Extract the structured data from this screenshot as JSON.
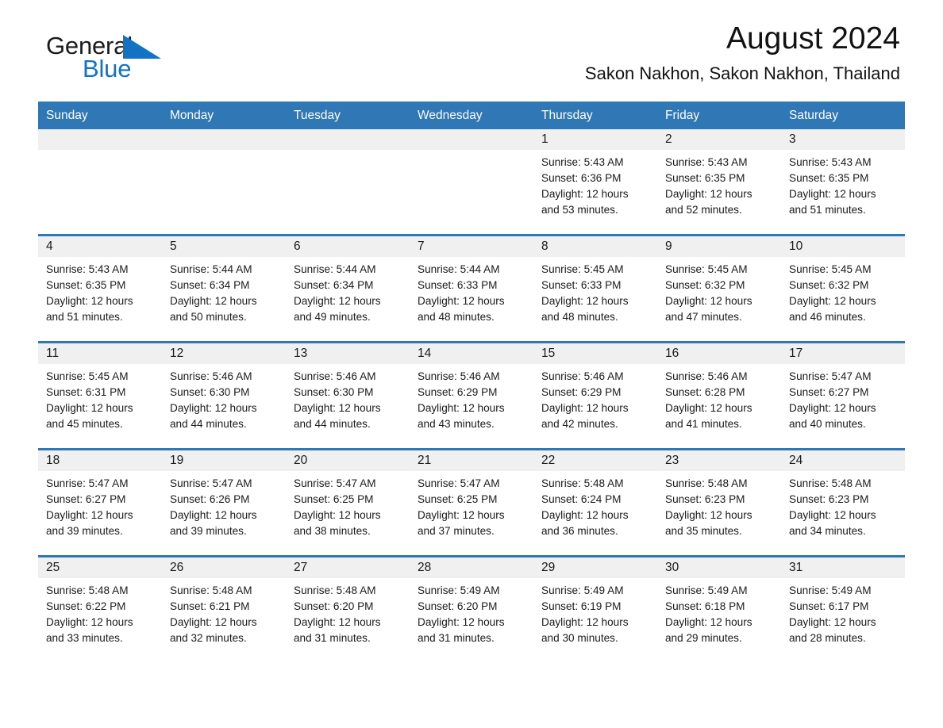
{
  "brand": {
    "name_part1": "General",
    "name_part2": "Blue",
    "flag_icon": "blue-triangle-flag-icon",
    "primary_color": "#1273c4"
  },
  "header": {
    "title": "August 2024",
    "subtitle": "Sakon Nakhon, Sakon Nakhon, Thailand"
  },
  "calendar": {
    "header_bg": "#3077b5",
    "row_divider": "#2f78b7",
    "day_band_bg": "#f0f0f0",
    "weekdays": [
      "Sunday",
      "Monday",
      "Tuesday",
      "Wednesday",
      "Thursday",
      "Friday",
      "Saturday"
    ],
    "weeks": [
      [
        {
          "day": "",
          "sunrise": "",
          "sunset": "",
          "daylight1": "",
          "daylight2": ""
        },
        {
          "day": "",
          "sunrise": "",
          "sunset": "",
          "daylight1": "",
          "daylight2": ""
        },
        {
          "day": "",
          "sunrise": "",
          "sunset": "",
          "daylight1": "",
          "daylight2": ""
        },
        {
          "day": "",
          "sunrise": "",
          "sunset": "",
          "daylight1": "",
          "daylight2": ""
        },
        {
          "day": "1",
          "sunrise": "Sunrise: 5:43 AM",
          "sunset": "Sunset: 6:36 PM",
          "daylight1": "Daylight: 12 hours",
          "daylight2": "and 53 minutes."
        },
        {
          "day": "2",
          "sunrise": "Sunrise: 5:43 AM",
          "sunset": "Sunset: 6:35 PM",
          "daylight1": "Daylight: 12 hours",
          "daylight2": "and 52 minutes."
        },
        {
          "day": "3",
          "sunrise": "Sunrise: 5:43 AM",
          "sunset": "Sunset: 6:35 PM",
          "daylight1": "Daylight: 12 hours",
          "daylight2": "and 51 minutes."
        }
      ],
      [
        {
          "day": "4",
          "sunrise": "Sunrise: 5:43 AM",
          "sunset": "Sunset: 6:35 PM",
          "daylight1": "Daylight: 12 hours",
          "daylight2": "and 51 minutes."
        },
        {
          "day": "5",
          "sunrise": "Sunrise: 5:44 AM",
          "sunset": "Sunset: 6:34 PM",
          "daylight1": "Daylight: 12 hours",
          "daylight2": "and 50 minutes."
        },
        {
          "day": "6",
          "sunrise": "Sunrise: 5:44 AM",
          "sunset": "Sunset: 6:34 PM",
          "daylight1": "Daylight: 12 hours",
          "daylight2": "and 49 minutes."
        },
        {
          "day": "7",
          "sunrise": "Sunrise: 5:44 AM",
          "sunset": "Sunset: 6:33 PM",
          "daylight1": "Daylight: 12 hours",
          "daylight2": "and 48 minutes."
        },
        {
          "day": "8",
          "sunrise": "Sunrise: 5:45 AM",
          "sunset": "Sunset: 6:33 PM",
          "daylight1": "Daylight: 12 hours",
          "daylight2": "and 48 minutes."
        },
        {
          "day": "9",
          "sunrise": "Sunrise: 5:45 AM",
          "sunset": "Sunset: 6:32 PM",
          "daylight1": "Daylight: 12 hours",
          "daylight2": "and 47 minutes."
        },
        {
          "day": "10",
          "sunrise": "Sunrise: 5:45 AM",
          "sunset": "Sunset: 6:32 PM",
          "daylight1": "Daylight: 12 hours",
          "daylight2": "and 46 minutes."
        }
      ],
      [
        {
          "day": "11",
          "sunrise": "Sunrise: 5:45 AM",
          "sunset": "Sunset: 6:31 PM",
          "daylight1": "Daylight: 12 hours",
          "daylight2": "and 45 minutes."
        },
        {
          "day": "12",
          "sunrise": "Sunrise: 5:46 AM",
          "sunset": "Sunset: 6:30 PM",
          "daylight1": "Daylight: 12 hours",
          "daylight2": "and 44 minutes."
        },
        {
          "day": "13",
          "sunrise": "Sunrise: 5:46 AM",
          "sunset": "Sunset: 6:30 PM",
          "daylight1": "Daylight: 12 hours",
          "daylight2": "and 44 minutes."
        },
        {
          "day": "14",
          "sunrise": "Sunrise: 5:46 AM",
          "sunset": "Sunset: 6:29 PM",
          "daylight1": "Daylight: 12 hours",
          "daylight2": "and 43 minutes."
        },
        {
          "day": "15",
          "sunrise": "Sunrise: 5:46 AM",
          "sunset": "Sunset: 6:29 PM",
          "daylight1": "Daylight: 12 hours",
          "daylight2": "and 42 minutes."
        },
        {
          "day": "16",
          "sunrise": "Sunrise: 5:46 AM",
          "sunset": "Sunset: 6:28 PM",
          "daylight1": "Daylight: 12 hours",
          "daylight2": "and 41 minutes."
        },
        {
          "day": "17",
          "sunrise": "Sunrise: 5:47 AM",
          "sunset": "Sunset: 6:27 PM",
          "daylight1": "Daylight: 12 hours",
          "daylight2": "and 40 minutes."
        }
      ],
      [
        {
          "day": "18",
          "sunrise": "Sunrise: 5:47 AM",
          "sunset": "Sunset: 6:27 PM",
          "daylight1": "Daylight: 12 hours",
          "daylight2": "and 39 minutes."
        },
        {
          "day": "19",
          "sunrise": "Sunrise: 5:47 AM",
          "sunset": "Sunset: 6:26 PM",
          "daylight1": "Daylight: 12 hours",
          "daylight2": "and 39 minutes."
        },
        {
          "day": "20",
          "sunrise": "Sunrise: 5:47 AM",
          "sunset": "Sunset: 6:25 PM",
          "daylight1": "Daylight: 12 hours",
          "daylight2": "and 38 minutes."
        },
        {
          "day": "21",
          "sunrise": "Sunrise: 5:47 AM",
          "sunset": "Sunset: 6:25 PM",
          "daylight1": "Daylight: 12 hours",
          "daylight2": "and 37 minutes."
        },
        {
          "day": "22",
          "sunrise": "Sunrise: 5:48 AM",
          "sunset": "Sunset: 6:24 PM",
          "daylight1": "Daylight: 12 hours",
          "daylight2": "and 36 minutes."
        },
        {
          "day": "23",
          "sunrise": "Sunrise: 5:48 AM",
          "sunset": "Sunset: 6:23 PM",
          "daylight1": "Daylight: 12 hours",
          "daylight2": "and 35 minutes."
        },
        {
          "day": "24",
          "sunrise": "Sunrise: 5:48 AM",
          "sunset": "Sunset: 6:23 PM",
          "daylight1": "Daylight: 12 hours",
          "daylight2": "and 34 minutes."
        }
      ],
      [
        {
          "day": "25",
          "sunrise": "Sunrise: 5:48 AM",
          "sunset": "Sunset: 6:22 PM",
          "daylight1": "Daylight: 12 hours",
          "daylight2": "and 33 minutes."
        },
        {
          "day": "26",
          "sunrise": "Sunrise: 5:48 AM",
          "sunset": "Sunset: 6:21 PM",
          "daylight1": "Daylight: 12 hours",
          "daylight2": "and 32 minutes."
        },
        {
          "day": "27",
          "sunrise": "Sunrise: 5:48 AM",
          "sunset": "Sunset: 6:20 PM",
          "daylight1": "Daylight: 12 hours",
          "daylight2": "and 31 minutes."
        },
        {
          "day": "28",
          "sunrise": "Sunrise: 5:49 AM",
          "sunset": "Sunset: 6:20 PM",
          "daylight1": "Daylight: 12 hours",
          "daylight2": "and 31 minutes."
        },
        {
          "day": "29",
          "sunrise": "Sunrise: 5:49 AM",
          "sunset": "Sunset: 6:19 PM",
          "daylight1": "Daylight: 12 hours",
          "daylight2": "and 30 minutes."
        },
        {
          "day": "30",
          "sunrise": "Sunrise: 5:49 AM",
          "sunset": "Sunset: 6:18 PM",
          "daylight1": "Daylight: 12 hours",
          "daylight2": "and 29 minutes."
        },
        {
          "day": "31",
          "sunrise": "Sunrise: 5:49 AM",
          "sunset": "Sunset: 6:17 PM",
          "daylight1": "Daylight: 12 hours",
          "daylight2": "and 28 minutes."
        }
      ]
    ]
  }
}
